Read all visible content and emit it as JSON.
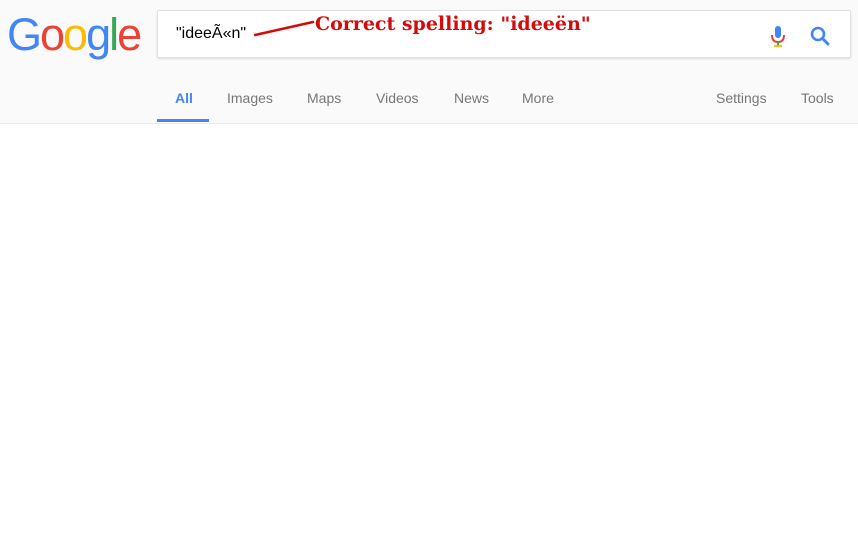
{
  "logo": {
    "letters": [
      "G",
      "o",
      "o",
      "g",
      "l",
      "e"
    ],
    "colors": [
      "#4285f4",
      "#ea4335",
      "#fbbc05",
      "#4285f4",
      "#34a853",
      "#ea4335"
    ]
  },
  "search": {
    "value": "\"ideeÃ«n\""
  },
  "annotation": {
    "text": "Correct spelling: \"ideeën\"",
    "color": "#d40b0b"
  },
  "tabs": [
    {
      "label": "All",
      "active": true
    },
    {
      "label": "Images"
    },
    {
      "label": "Maps"
    },
    {
      "label": "Videos"
    },
    {
      "label": "News"
    },
    {
      "label": "More"
    }
  ],
  "right_tabs": [
    {
      "label": "Settings"
    },
    {
      "label": "Tools"
    }
  ],
  "icons": {
    "mic": "microphone-icon",
    "search": "search-icon"
  },
  "colors": {
    "accent": "#4285f4"
  }
}
